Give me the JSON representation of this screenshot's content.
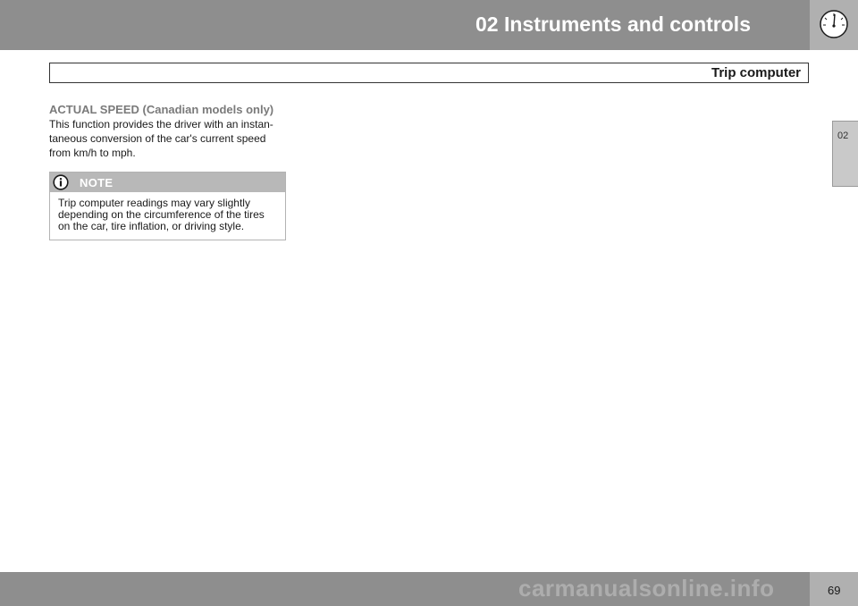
{
  "header": {
    "chapter_title": "02 Instruments and controls",
    "icon": "speedometer-gauge-icon"
  },
  "section": {
    "title": "Trip computer"
  },
  "side_tab": {
    "label": "02"
  },
  "content": {
    "subheading": "ACTUAL SPEED (Canadian models only)",
    "body_lines": [
      "This function provides the driver with an instan-",
      "taneous conversion of the car's current speed",
      "from km/h to mph."
    ]
  },
  "note": {
    "icon": "info-icon",
    "label": "NOTE",
    "lines": [
      "Trip computer readings may vary slightly",
      "depending on the circumference of the tires",
      "on the car, tire inflation, or driving style."
    ]
  },
  "footer": {
    "page_number": "69",
    "watermark": "carmanualsonline.info"
  },
  "colors": {
    "header_gray": "#8e8e8e",
    "icon_box_gray": "#b0b0b0",
    "subheading_gray": "#7a7a7a",
    "note_header_gray": "#b8b8b8"
  }
}
